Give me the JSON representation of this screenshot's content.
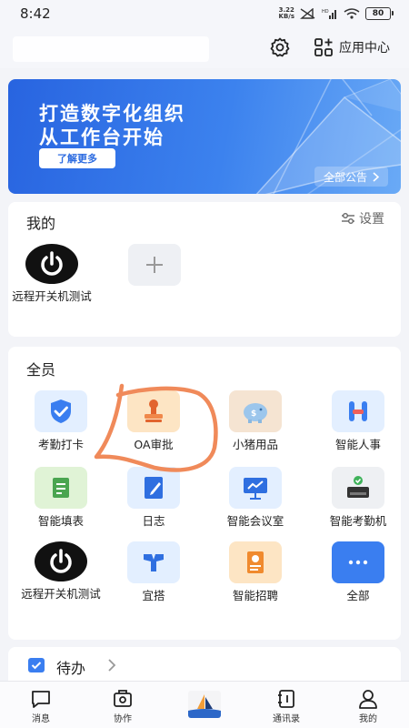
{
  "status_bar": {
    "time": "8:42",
    "net_speed_value": "3.22",
    "net_speed_unit": "KB/s",
    "battery": "80"
  },
  "header": {
    "app_center_label": "应用中心"
  },
  "banner": {
    "title_line1": "打造数字化组织",
    "title_line2": "从工作台开始",
    "learn_more": "了解更多",
    "all_notices": "全部公告"
  },
  "mine": {
    "title": "我的",
    "settings_label": "设置",
    "apps": [
      {
        "label": "远程开关机测试",
        "icon": "power-icon"
      }
    ]
  },
  "all_staff": {
    "title": "全员",
    "apps": [
      {
        "label": "考勤打卡",
        "icon": "attendance-check-icon"
      },
      {
        "label": "OA审批",
        "icon": "stamp-icon"
      },
      {
        "label": "小猪用品",
        "icon": "piggy-bank-icon"
      },
      {
        "label": "智能人事",
        "icon": "hr-icon"
      },
      {
        "label": "智能填表",
        "icon": "form-scroll-icon"
      },
      {
        "label": "日志",
        "icon": "journal-icon"
      },
      {
        "label": "智能会议室",
        "icon": "meeting-screen-icon"
      },
      {
        "label": "智能考勤机",
        "icon": "attendance-machine-icon"
      },
      {
        "label": "远程开关机测试",
        "icon": "power-icon"
      },
      {
        "label": "宜搭",
        "icon": "yida-icon"
      },
      {
        "label": "智能招聘",
        "icon": "recruit-icon"
      },
      {
        "label": "全部",
        "icon": "more-icon"
      }
    ]
  },
  "todo": {
    "title": "待办"
  },
  "tabs": [
    {
      "label": "消息",
      "icon": "message-icon"
    },
    {
      "label": "协作",
      "icon": "collaborate-icon"
    },
    {
      "label": "",
      "icon": "workbench-logo-icon"
    },
    {
      "label": "通讯录",
      "icon": "contacts-icon"
    },
    {
      "label": "我的",
      "icon": "profile-icon"
    }
  ],
  "colors": {
    "accent": "#3a7ef0",
    "annotation": "#f08a5a"
  }
}
